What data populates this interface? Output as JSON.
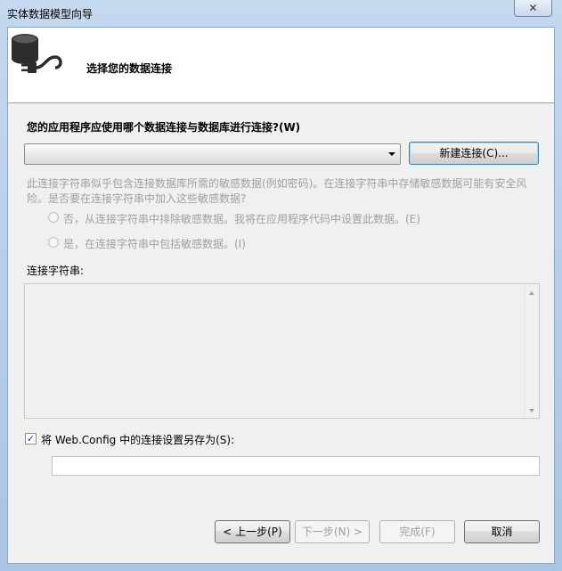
{
  "window": {
    "title": "实体数据模型向导",
    "close_glyph": "✕"
  },
  "header": {
    "title": "选择您的数据连接",
    "icon": "database-plug-icon"
  },
  "question": "您的应用程序应使用哪个数据连接与数据库进行连接?(W)",
  "connection_select": {
    "value": ""
  },
  "new_connection_button": "新建连接(C)...",
  "sensitive_note": "此连接字符串似乎包含连接数据库所需的敏感数据(例如密码)。在连接字符串中存储敏感数据可能有安全风险。是否要在连接字符串中加入这些敏感数据?",
  "options": {
    "exclude": "否，从连接字符串中排除敏感数据。我将在应用程序代码中设置此数据。(E)",
    "include": "是，在连接字符串中包括敏感数据。(I)"
  },
  "connection_string": {
    "label": "连接字符串:",
    "value": ""
  },
  "save": {
    "label": "将 Web.Config 中的连接设置另存为(S):",
    "checked": true,
    "value": ""
  },
  "buttons": {
    "back": "< 上一步(P)",
    "next": "下一步(N) >",
    "finish": "完成(F)",
    "cancel": "取消"
  }
}
